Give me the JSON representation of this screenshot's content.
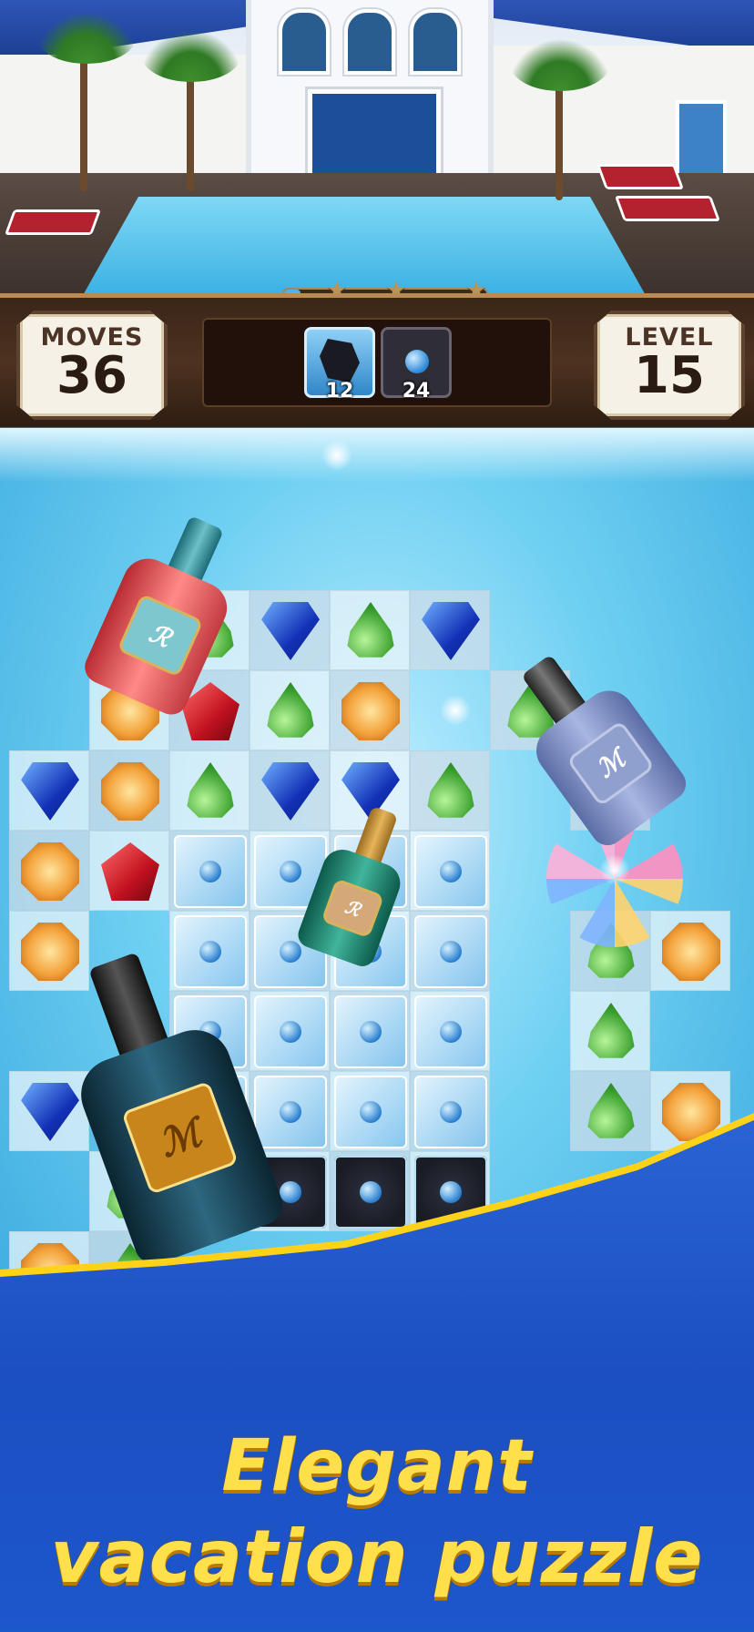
{
  "hud": {
    "moves_label": "MOVES",
    "moves_value": "36",
    "level_label": "LEVEL",
    "level_value": "15",
    "goals": [
      {
        "icon": "ice-shard-icon",
        "count": "12"
      },
      {
        "icon": "frozen-flower-icon",
        "count": "24"
      }
    ],
    "score_progress": 0.08,
    "stars_count": 3
  },
  "tagline": {
    "line1": "Elegant",
    "line2": "vacation puzzle"
  },
  "colors": {
    "banner_blue": "#1f56c9",
    "tagline_yellow": "#ffe04a",
    "hud_brown": "#3a2618"
  }
}
